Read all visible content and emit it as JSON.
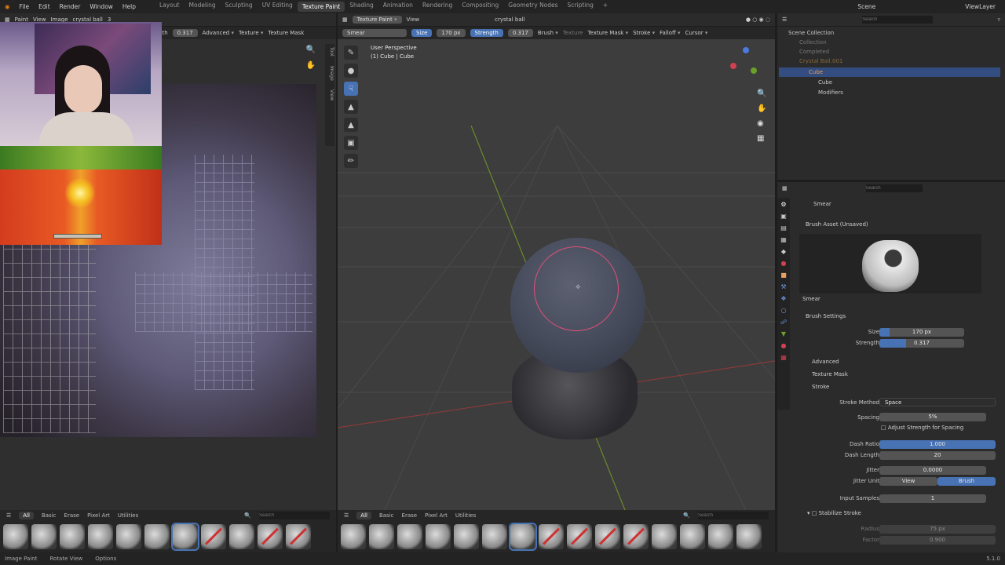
{
  "menus": [
    "File",
    "Edit",
    "Render",
    "Window",
    "Help"
  ],
  "workspaces": [
    "Layout",
    "Modeling",
    "Sculpting",
    "UV Editing",
    "Texture Paint",
    "Shading",
    "Animation",
    "Rendering",
    "Compositing",
    "Geometry Nodes",
    "Scripting"
  ],
  "active_workspace": "Texture Paint",
  "scene": "Scene",
  "view_layer": "ViewLayer",
  "image_editor": {
    "mode": "Paint",
    "view": "View",
    "image": "Image",
    "image_name": "crystal ball",
    "user_count": "3",
    "strength_label": "gth",
    "strength_value": "0.317",
    "advanced": "Advanced",
    "texture": "Texture",
    "texture_mask": "Texture Mask",
    "side_tabs": [
      "Tool",
      "Image",
      "View"
    ]
  },
  "viewport": {
    "mode": "Texture Paint",
    "view": "View",
    "material": "crystal ball",
    "brush": "Smear",
    "size_label": "Size",
    "size_value": "170 px",
    "strength_label": "Strength",
    "strength_value": "0.317",
    "brush_menu": "Brush",
    "texture": "Texture",
    "texture_mask": "Texture Mask",
    "stroke": "Stroke",
    "falloff": "Falloff",
    "cursor": "Cursor",
    "perspective": "User Perspective",
    "object": "(1) Cube | Cube"
  },
  "asset_bar": {
    "tabs": [
      "All",
      "Basic",
      "Erase",
      "Pixel Art",
      "Utilities"
    ],
    "search_placeholder": "Search"
  },
  "outliner": {
    "search_placeholder": "Search",
    "root": "Scene Collection",
    "items": [
      "Collection",
      "Completed",
      "Crystal Ball.001",
      "Cube",
      "Cube",
      "Modifiers"
    ]
  },
  "properties": {
    "search_placeholder": "Search",
    "tool_name": "Smear",
    "brush_asset": "Brush Asset (Unsaved)",
    "brush_preview_name": "Smear",
    "brush_settings": "Brush Settings",
    "size_label": "Size",
    "size_value": "170 px",
    "size_frac": 0.12,
    "strength_label": "Strength",
    "strength_value": "0.317",
    "strength_frac": 0.317,
    "advanced": "Advanced",
    "texture_mask": "Texture Mask",
    "stroke": "Stroke",
    "stroke_method_label": "Stroke Method",
    "stroke_method": "Space",
    "spacing_label": "Spacing",
    "spacing_value": "5%",
    "adjust_strength": "Adjust Strength for Spacing",
    "dash_ratio_label": "Dash Ratio",
    "dash_ratio": "1.000",
    "dash_length_label": "Dash Length",
    "dash_length": "20",
    "jitter_label": "Jitter",
    "jitter": "0.0000",
    "jitter_unit_label": "Jitter Unit",
    "jitter_unit_view": "View",
    "jitter_unit_brush": "Brush",
    "input_samples_label": "Input Samples",
    "input_samples": "1",
    "stabilize": "Stabilize Stroke",
    "radius_label": "Radius",
    "radius": "75 px",
    "factor_label": "Factor",
    "factor": "0.900"
  },
  "status": {
    "left": "Image Paint",
    "middle": "Rotate View",
    "right": "Options",
    "version": "5.1.0"
  },
  "colors": {
    "accent": "#4772b3",
    "brush_ring": "#e0507a",
    "bg": "#1d1d1d"
  }
}
